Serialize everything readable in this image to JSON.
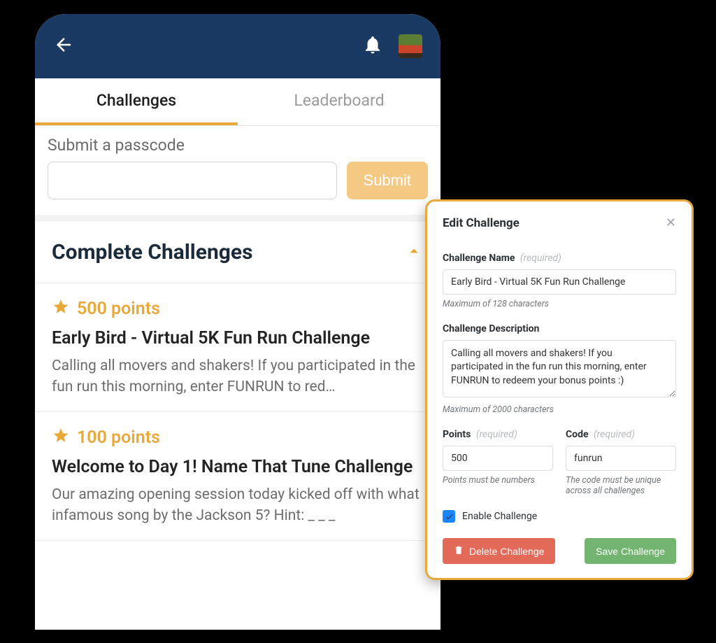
{
  "colors": {
    "header_bg": "#1b3a63",
    "accent": "#e9a93a",
    "btn_submit_bg": "#f3c983",
    "btn_delete_bg": "#e36a58",
    "btn_save_bg": "#74b471",
    "checkbox_bg": "#1a86ff"
  },
  "tabs": {
    "challenges": "Challenges",
    "leaderboard": "Leaderboard"
  },
  "passcode": {
    "label": "Submit a passcode",
    "submit_btn": "Submit"
  },
  "section": {
    "title": "Complete Challenges"
  },
  "challenges": [
    {
      "points_label": "500 points",
      "title": "Early Bird - Virtual 5K Fun Run Challenge",
      "desc": "Calling all movers and shakers! If you participated in the fun run this morning, enter FUNRUN to red…"
    },
    {
      "points_label": "100 points",
      "title": "Welcome to Day 1! Name That Tune Challenge",
      "desc": "Our amazing opening session today kicked off with what infamous song by the Jackson 5? Hint: _ _ _"
    }
  ],
  "panel": {
    "title": "Edit Challenge",
    "labels": {
      "name": "Challenge Name",
      "desc": "Challenge Description",
      "points": "Points",
      "code": "Code",
      "enable": "Enable Challenge",
      "required": "(required)"
    },
    "helpers": {
      "name": "Maximum of 128 characters",
      "desc": "Maximum of 2000 characters",
      "points": "Points must be numbers",
      "code": "The code must be unique across all challenges"
    },
    "values": {
      "name": "Early Bird - Virtual 5K Fun Run Challenge",
      "desc": "Calling all movers and shakers! If you participated in the fun run this morning, enter FUNRUN to redeem your bonus points :)",
      "points": "500",
      "code": "funrun",
      "enable_checked": true
    },
    "buttons": {
      "delete": "Delete Challenge",
      "save": "Save Challenge"
    }
  }
}
